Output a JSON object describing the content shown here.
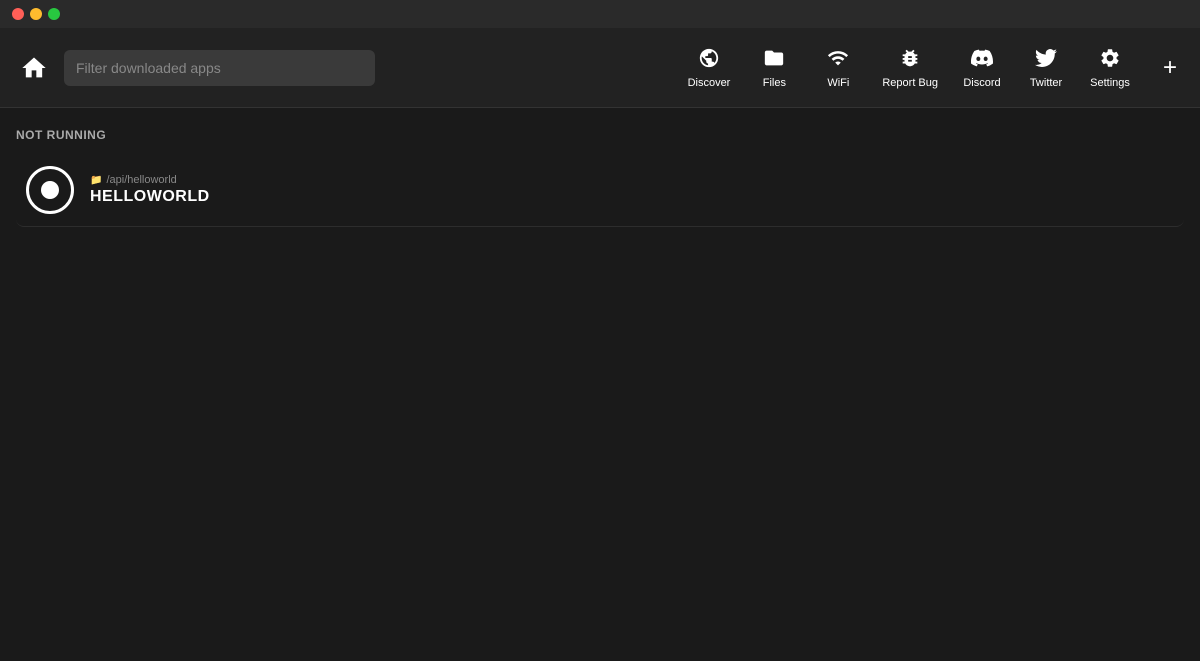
{
  "titleBar": {
    "trafficLights": {
      "close": "close",
      "minimize": "minimize",
      "maximize": "maximize"
    }
  },
  "toolbar": {
    "homeLabel": "Home",
    "searchPlaceholder": "Filter downloaded apps",
    "navItems": [
      {
        "id": "discover",
        "label": "Discover",
        "icon": "🌐"
      },
      {
        "id": "files",
        "label": "Files",
        "icon": "📁"
      },
      {
        "id": "wifi",
        "label": "WiFi",
        "icon": "📶"
      },
      {
        "id": "report-bug",
        "label": "Report Bug",
        "icon": "🐛"
      },
      {
        "id": "discord",
        "label": "Discord",
        "icon": "💬"
      },
      {
        "id": "twitter",
        "label": "Twitter",
        "icon": "🐦"
      },
      {
        "id": "settings",
        "label": "Settings",
        "icon": "⚙️"
      }
    ],
    "addButtonLabel": "+"
  },
  "mainContent": {
    "sectionTitle": "NOT RUNNING",
    "apps": [
      {
        "id": "helloworld",
        "path": "/api/helloworld",
        "name": "HELLOWORLD"
      }
    ]
  }
}
